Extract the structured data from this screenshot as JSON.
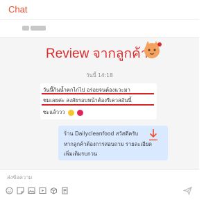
{
  "header": {
    "title": "Chat"
  },
  "conversation": {
    "banner": {
      "text": "Review จากลูกค้า",
      "sticker_icon": "cat-sticker-icon",
      "color": "#d92b2b"
    },
    "timestamp": "วันนี้ 14:18",
    "incoming": {
      "lines": [
        "วันนี้กินน้ำตกไก่ไป อร่อยจนต้องแวะมา",
        "ชมเลยค่ะ สงสัยรอบหน้าต้องรีเควสอันนี้",
        "ซะแล้ววว"
      ],
      "emojis": [
        "smile-emoji",
        "heart-emoji"
      ]
    },
    "outgoing": {
      "lines": [
        "ร้าน Dailycleanfood สวัสดีครับ",
        "หากลูกค้าต้องการสอบถาม รายละเอียด",
        "เพิ่มเติมรบกวน"
      ],
      "icon": "download-arrow-icon",
      "color": "#d9e9ff"
    }
  },
  "composer": {
    "placeholder": "ส่งข้อความ",
    "toolbar_icons": [
      "emoji-icon",
      "sticker-icon",
      "image-icon",
      "video-icon",
      "product-icon",
      "order-icon"
    ],
    "send_icon": "send-icon"
  },
  "colors": {
    "accent": "#ee4d2d",
    "highlight": "#d62424"
  }
}
